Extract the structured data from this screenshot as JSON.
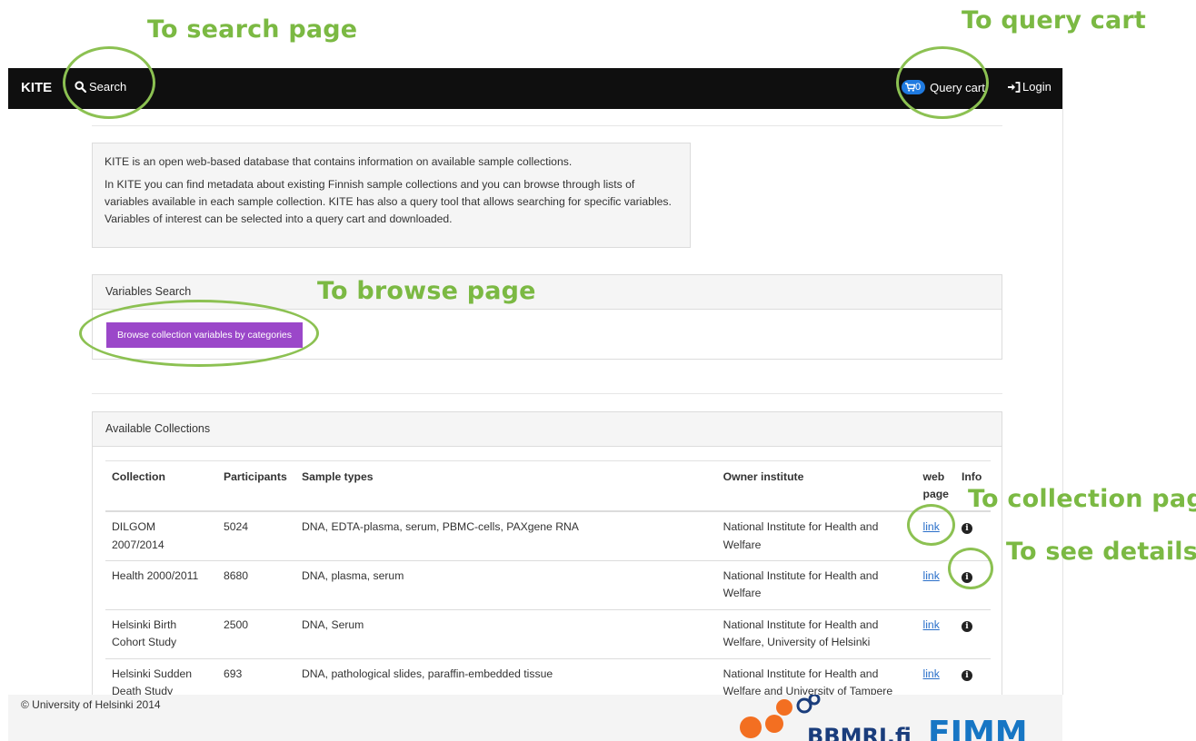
{
  "annotations": {
    "search_page": "To search page",
    "query_cart": "To query cart",
    "browse_page": "To browse page",
    "collection_page": "To collection page",
    "see_details": "To see details"
  },
  "navbar": {
    "brand": "KITE",
    "search_label": "Search",
    "cart_count": "0",
    "cart_label": "Query cart",
    "login_label": "Login"
  },
  "intro": {
    "p1": "KITE is an open web-based database that contains information on available sample collections.",
    "p2": "In KITE you can find metadata about existing Finnish sample collections and you can browse through lists of variables available in each sample collection. KITE has also a query tool that allows searching for specific variables. Variables of interest can be selected into a query cart and downloaded."
  },
  "variables_search": {
    "title": "Variables Search",
    "browse_button": "Browse collection variables by categories"
  },
  "collections": {
    "title": "Available Collections",
    "headers": [
      "Collection",
      "Participants",
      "Sample types",
      "Owner institute",
      "web page",
      "Info"
    ],
    "rows": [
      {
        "collection": "DILGOM 2007/2014",
        "participants": "5024",
        "sample_types": "DNA, EDTA-plasma, serum, PBMC-cells, PAXgene RNA",
        "owner": "National Institute for Health and Welfare",
        "link": "link"
      },
      {
        "collection": "Health 2000/2011",
        "participants": "8680",
        "sample_types": "DNA, plasma, serum",
        "owner": "National Institute for Health and Welfare",
        "link": "link"
      },
      {
        "collection": "Helsinki Birth Cohort Study",
        "participants": "2500",
        "sample_types": "DNA, Serum",
        "owner": "National Institute for Health and Welfare, University of Helsinki",
        "link": "link"
      },
      {
        "collection": "Helsinki Sudden Death Study",
        "participants": "693",
        "sample_types": "DNA, pathological slides, paraffin-embedded tissue",
        "owner": "National Institute for Health and Welfare and University of Tampere",
        "link": "link"
      }
    ]
  },
  "footer": {
    "copyright": "© University of Helsinki 2014",
    "logo_bbmri": "BBMRI.fi",
    "logo_fimm": "FIMM"
  },
  "colors": {
    "annotation": "#7bb943",
    "navbar": "#0f0f0f",
    "browse_button": "#9b47c9",
    "cart_badge": "#1f7ae0",
    "link": "#2a6fc9"
  }
}
